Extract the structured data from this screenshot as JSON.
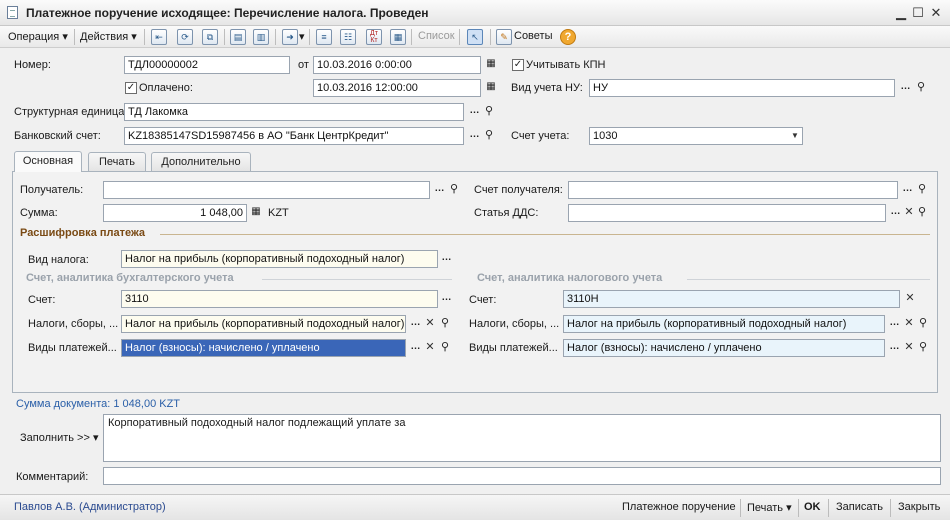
{
  "window": {
    "title": "Платежное поручение исходящее: Перечисление налога. Проведен"
  },
  "toolbar": {
    "operation": "Операция",
    "actions": "Действия",
    "list": "Список",
    "tips": "Советы",
    "dt_kt": "Дт Кт"
  },
  "header": {
    "number_label": "Номер:",
    "number_value": "ТДЛ00000002",
    "from_label": "от",
    "date_value": "10.03.2016  0:00:00",
    "kpn_label": "Учитывать КПН",
    "kpn_checked": "✓",
    "paid_label": "Оплачено:",
    "paid_checked": "✓",
    "paid_date": "10.03.2016 12:00:00",
    "nu_label": "Вид учета НУ:",
    "nu_value": "НУ",
    "unit_label": "Структурная единица:",
    "unit_value": "ТД Лакомка",
    "bank_label": "Банковский счет:",
    "bank_value": "KZ18385147SD15987456 в АО \"Банк ЦентрКредит\"",
    "account_label": "Счет учета:",
    "account_value": "1030"
  },
  "tabs": [
    {
      "label": "Основная"
    },
    {
      "label": "Печать"
    },
    {
      "label": "Дополнительно"
    }
  ],
  "main": {
    "recipient_label": "Получатель:",
    "recipient_value": "",
    "recipient_account_label": "Счет получателя:",
    "recipient_account_value": "",
    "sum_label": "Сумма:",
    "sum_value": "1 048,00",
    "currency": "KZT",
    "dds_label": "Статья ДДС:",
    "dds_value": "",
    "decode_title": "Расшифровка платежа",
    "tax_type_label": "Вид налога:",
    "tax_type_value": "Налог на прибыль (корпоративный подоходный налог)",
    "buh_group_title": "Счет, аналитика бухгалтерского учета",
    "tax_group_title": "Счет, аналитика налогового учета",
    "buh_account_label": "Счет:",
    "buh_account_value": "3110",
    "buh_taxes_label": "Налоги, сборы, ...",
    "buh_taxes_value": "Налог на прибыль (корпоративный подоходный налог)",
    "buh_payments_label": "Виды платежей...",
    "buh_payments_value": "Налог (взносы): начислено / уплачено",
    "nu_account_label": "Счет:",
    "nu_account_value": "3110Н",
    "nu_taxes_label": "Налоги, сборы, ...",
    "nu_taxes_value": "Налог на прибыль (корпоративный подоходный налог)",
    "nu_payments_label": "Виды платежей...",
    "nu_payments_value": "Налог (взносы): начислено / уплачено"
  },
  "footer": {
    "doc_sum": "Сумма документа: 1 048,00 KZT",
    "fill_label": "Заполнить >>",
    "purpose_value": "Корпоративный подоходный налог подлежащий уплате за",
    "comment_label": "Комментарий:",
    "comment_value": ""
  },
  "statusbar": {
    "user": "Павлов А.В. (Администратор)",
    "payment_order": "Платежное поручение",
    "print": "Печать",
    "ok": "OK",
    "save": "Записать",
    "close": "Закрыть"
  },
  "colors": {
    "selected_field": "#3a66b8",
    "section_title": "#7a4a14",
    "doc_sum_text": "#2a5fa8"
  }
}
